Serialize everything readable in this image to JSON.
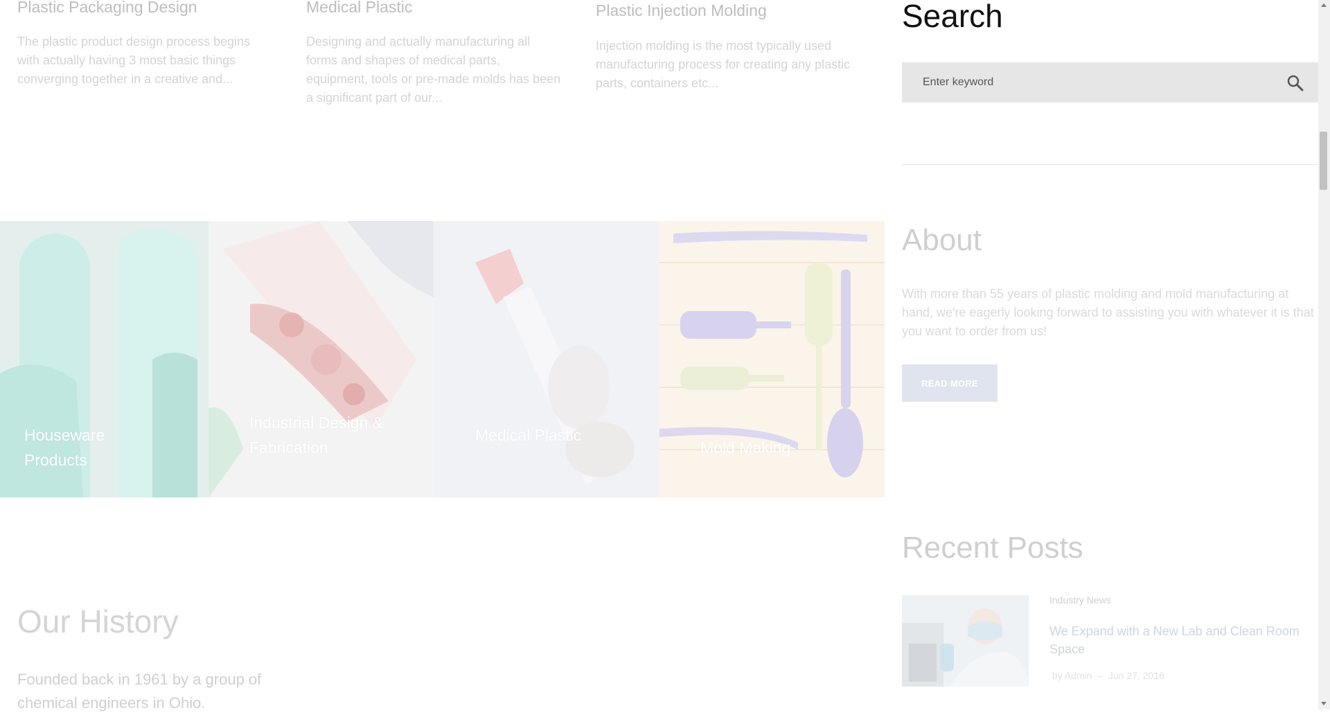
{
  "features": [
    {
      "title": "Plastic Packaging Design",
      "desc": "The plastic product design process begins with actually having 3 most basic things converging together in a creative and..."
    },
    {
      "title": "Medical Plastic",
      "desc": "Designing and actually manufacturing all forms and shapes of medical parts, equipment, tools or pre-made molds has been a significant part of our..."
    },
    {
      "title": "Plastic Injection Molding",
      "desc": "Injection molding is the most typically used manufacturing process for creating any plastic parts, containers etc..."
    }
  ],
  "sidebar": {
    "search": {
      "title": "Search",
      "placeholder": "Enter keyword",
      "icon": "search-icon"
    },
    "about": {
      "title": "About",
      "text": "With more than 55 years of plastic molding and mold manufacturing at hand, we're eagerly looking forward to assisting you with whatever it is that you want to order from us!",
      "button": "READ MORE"
    },
    "recent_posts": {
      "title": "Recent Posts",
      "posts": [
        {
          "category": "Industry News",
          "title": "We Expand with a New Lab and Clean Room Space",
          "author": "by Admin",
          "date": "Jun 27, 2016"
        }
      ]
    }
  },
  "tiles": [
    {
      "label": "Houseware Products"
    },
    {
      "label": "Industrial Design & Fabrication"
    },
    {
      "label": "Medical Plastic"
    },
    {
      "label": "Mold Making"
    }
  ],
  "history": {
    "title": "Our History",
    "text": "Founded back in 1961 by a group of chemical engineers in Ohio."
  },
  "colors": {
    "accent": "#dfe4ee",
    "search_bg": "#e6e6e6",
    "heading": "#111111"
  }
}
